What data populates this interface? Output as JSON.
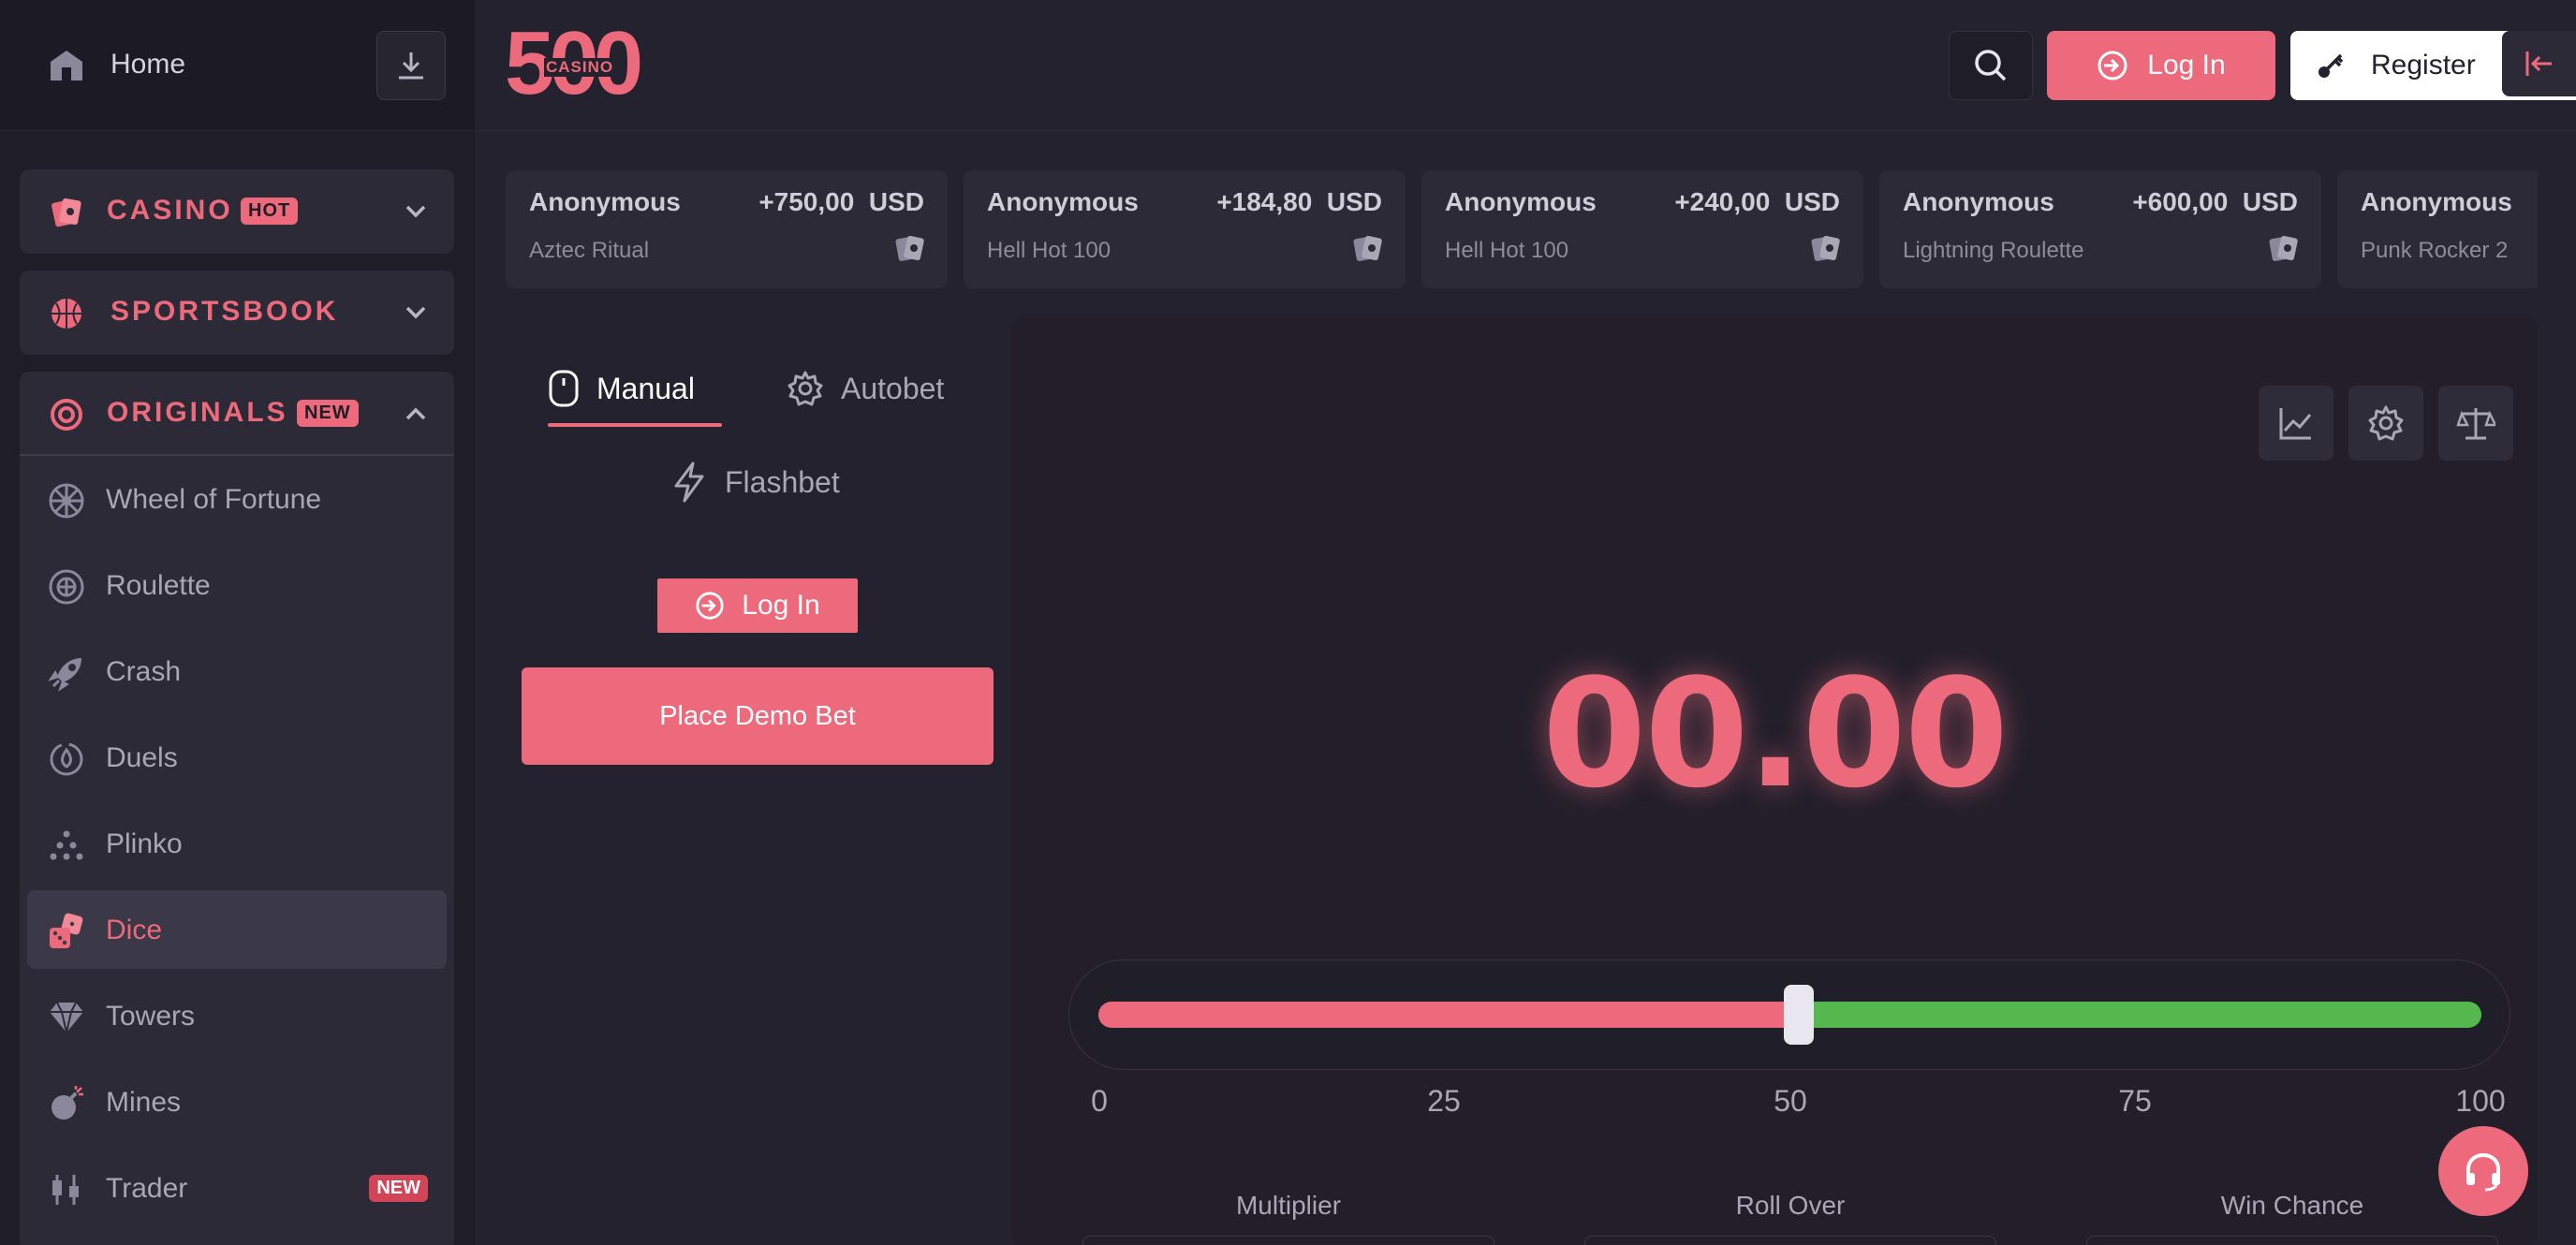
{
  "sidebar": {
    "home_label": "Home",
    "sections": [
      {
        "label": "CASINO",
        "badge": "HOT"
      },
      {
        "label": "SPORTSBOOK"
      },
      {
        "label": "ORIGINALS",
        "badge": "NEW"
      }
    ],
    "games": [
      {
        "label": "Wheel of Fortune",
        "icon": "wheel-icon"
      },
      {
        "label": "Roulette",
        "icon": "roulette-icon"
      },
      {
        "label": "Crash",
        "icon": "rocket-icon"
      },
      {
        "label": "Duels",
        "icon": "duels-icon"
      },
      {
        "label": "Plinko",
        "icon": "plinko-icon"
      },
      {
        "label": "Dice",
        "icon": "dice-icon",
        "active": true
      },
      {
        "label": "Towers",
        "icon": "diamond-icon"
      },
      {
        "label": "Mines",
        "icon": "bomb-icon"
      },
      {
        "label": "Trader",
        "icon": "candles-icon",
        "badge": "NEW"
      }
    ]
  },
  "header": {
    "logo_number": "500",
    "logo_text": "CASINO",
    "login_label": "Log In",
    "register_label": "Register"
  },
  "wins": [
    {
      "user": "Anonymous",
      "amount": "+750,00",
      "currency": "USD",
      "game": "Aztec Ritual"
    },
    {
      "user": "Anonymous",
      "amount": "+184,80",
      "currency": "USD",
      "game": "Hell Hot 100"
    },
    {
      "user": "Anonymous",
      "amount": "+240,00",
      "currency": "USD",
      "game": "Hell Hot 100"
    },
    {
      "user": "Anonymous",
      "amount": "+600,00",
      "currency": "USD",
      "game": "Lightning Roulette"
    },
    {
      "user": "Anonymous",
      "amount": "",
      "currency": "",
      "game": "Punk Rocker 2"
    }
  ],
  "bet": {
    "tab_manual": "Manual",
    "tab_autobet": "Autobet",
    "flashbet": "Flashbet",
    "login_label": "Log In",
    "demo_bet_label": "Place Demo Bet"
  },
  "game": {
    "result": "00.00",
    "slider_value": 50,
    "ticks": [
      "0",
      "25",
      "50",
      "75",
      "100"
    ],
    "stats": [
      "Multiplier",
      "Roll Over",
      "Win Chance"
    ]
  },
  "colors": {
    "accent": "#ec6a7c",
    "win_green": "#55b84f",
    "background": "#24222e"
  }
}
